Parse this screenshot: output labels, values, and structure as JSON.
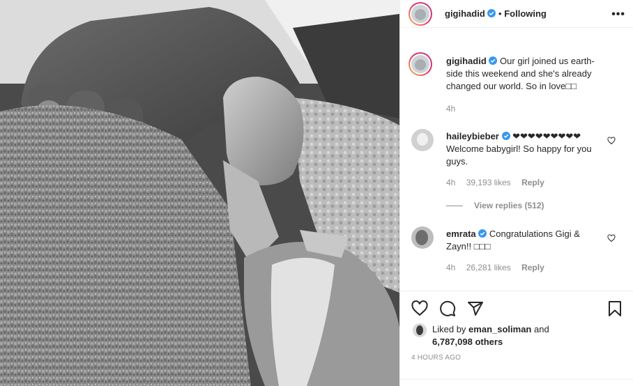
{
  "post": {
    "username": "gigihadid",
    "follow_status": "Following",
    "more_label": "•••"
  },
  "caption": {
    "username": "gigihadid",
    "text": "Our girl joined us earth-side this weekend and she's already changed our world. So in love□□",
    "time": "4h"
  },
  "comments": [
    {
      "username": "haileybieber",
      "text": "❤❤❤❤❤❤❤❤❤ Welcome babygirl! So happy for you guys.",
      "time": "4h",
      "likes": "39,193 likes",
      "reply_label": "Reply",
      "view_replies": "View replies (512)"
    },
    {
      "username": "emrata",
      "text": "Congratulations Gigi & Zayn!! □□□",
      "time": "4h",
      "likes": "26,281 likes",
      "reply_label": "Reply"
    }
  ],
  "likes": {
    "prefix": "Liked by ",
    "user": "eman_soliman",
    "middle": " and",
    "count": "6,787,098 others"
  },
  "timestamp": "4 HOURS AGO",
  "icons": {
    "like": "heart-icon",
    "comment": "comment-icon",
    "share": "share-icon",
    "save": "bookmark-icon",
    "verified": "verified-badge-icon"
  },
  "colors": {
    "verified": "#3897f0",
    "muted": "#8e8e8e",
    "text": "#262626"
  }
}
